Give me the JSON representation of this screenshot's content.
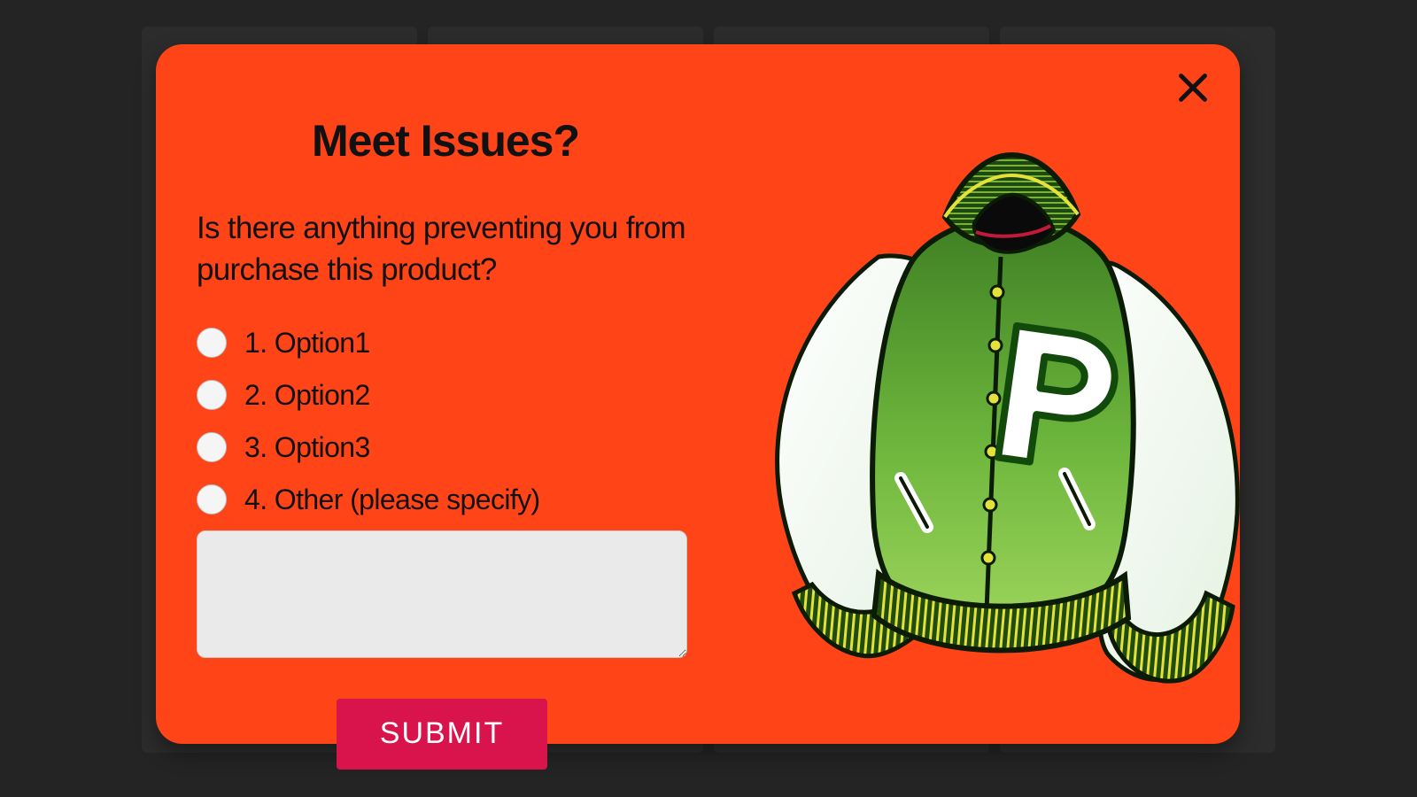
{
  "modal": {
    "title": "Meet Issues?",
    "question": "Is there anything preventing you from purchase this product?",
    "options": [
      {
        "label": "1. Option1"
      },
      {
        "label": "2. Option2"
      },
      {
        "label": "3. Option3"
      },
      {
        "label": "4. Other (please specify)"
      }
    ],
    "other_value": "",
    "submit": "SUBMIT"
  },
  "colors": {
    "modal_bg": "#FF4417",
    "submit_bg": "#D9134B",
    "jacket_body": "#4F9B2F",
    "jacket_body_light": "#8FCB57",
    "jacket_sleeve": "#FFFFFF",
    "jacket_trim_dark": "#214D0F",
    "jacket_trim_accent": "#E4E23A"
  },
  "illustration": {
    "name": "varsity-jacket",
    "letter": "P"
  }
}
